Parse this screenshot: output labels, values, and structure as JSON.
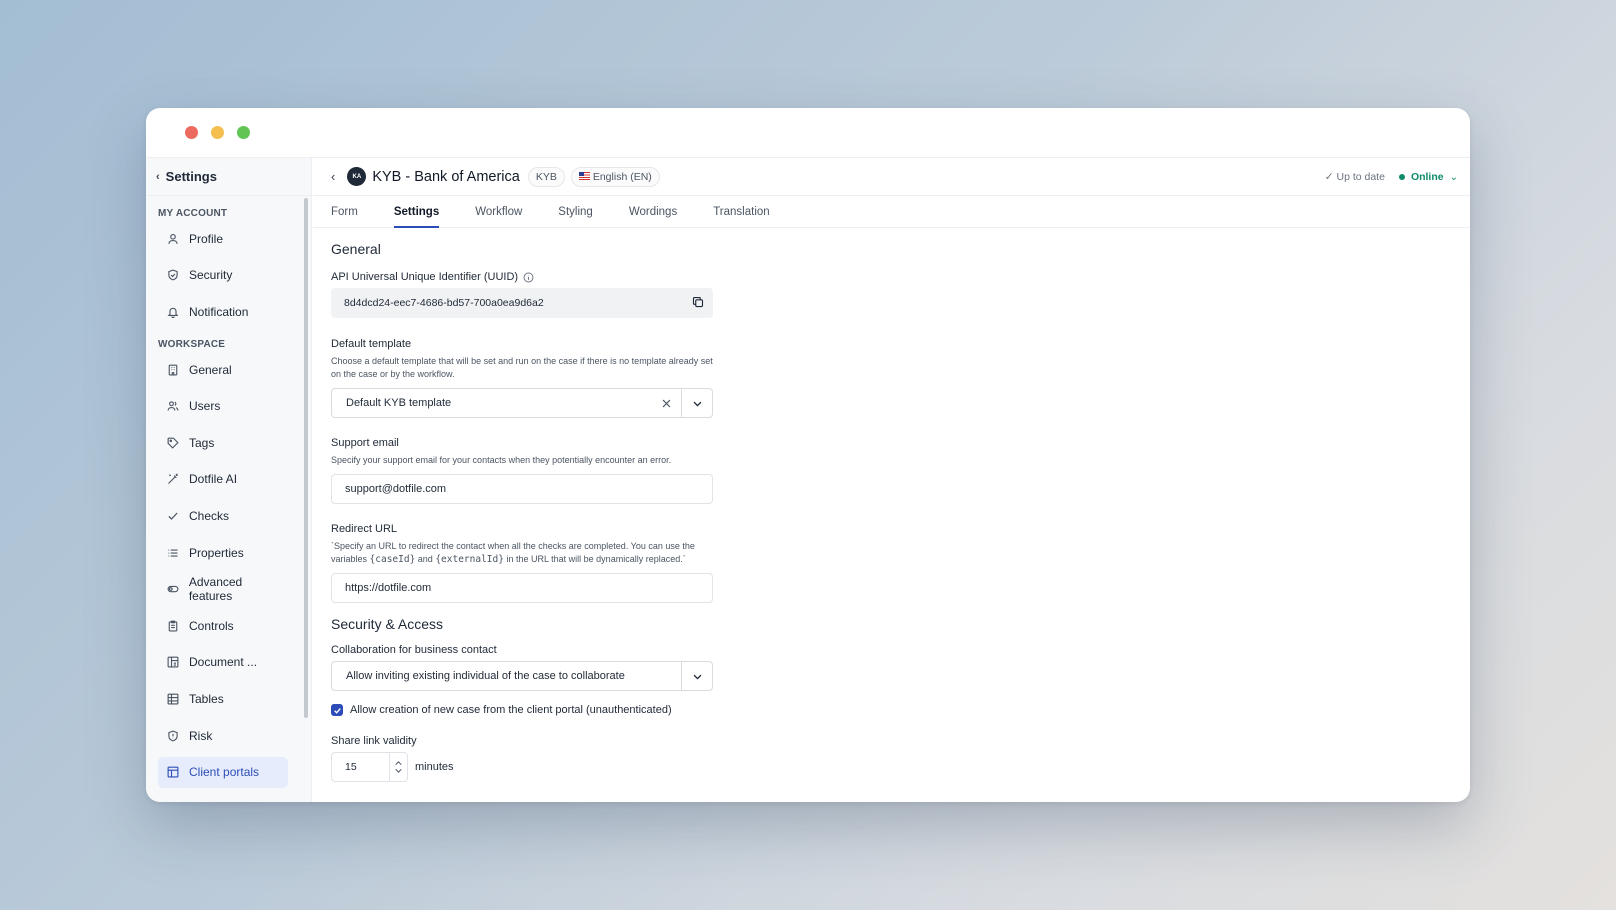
{
  "sidebar": {
    "title": "Settings",
    "sections": [
      {
        "label": "MY ACCOUNT"
      },
      {
        "label": "WORKSPACE"
      }
    ],
    "items": [
      {
        "label": "Profile",
        "icon": "user-icon"
      },
      {
        "label": "Security",
        "icon": "shield-icon"
      },
      {
        "label": "Notification",
        "icon": "bell-icon"
      },
      {
        "label": "General",
        "icon": "building-icon"
      },
      {
        "label": "Users",
        "icon": "users-icon"
      },
      {
        "label": "Tags",
        "icon": "tag-icon"
      },
      {
        "label": "Dotfile AI",
        "icon": "wand-icon"
      },
      {
        "label": "Checks",
        "icon": "check-icon"
      },
      {
        "label": "Properties",
        "icon": "list-icon"
      },
      {
        "label": "Advanced features",
        "icon": "toggle-icon"
      },
      {
        "label": "Controls",
        "icon": "clipboard-icon"
      },
      {
        "label": "Document ...",
        "icon": "document-icon"
      },
      {
        "label": "Tables",
        "icon": "table-icon"
      },
      {
        "label": "Risk",
        "icon": "shield-alert-icon"
      },
      {
        "label": "Client portals",
        "icon": "layout-icon"
      }
    ]
  },
  "header": {
    "avatar_initials": "KA",
    "case_title": "KYB - Bank of America",
    "type_chip": "KYB",
    "language_chip": "English (EN)",
    "status": "Up to date",
    "online": "Online"
  },
  "tabs": [
    {
      "label": "Form"
    },
    {
      "label": "Settings"
    },
    {
      "label": "Workflow"
    },
    {
      "label": "Styling"
    },
    {
      "label": "Wordings"
    },
    {
      "label": "Translation"
    }
  ],
  "general": {
    "title": "General",
    "uuid_label": "API Universal Unique Identifier (UUID)",
    "uuid_value": "8d4dcd24-eec7-4686-bd57-700a0ea9d6a2",
    "template_label": "Default template",
    "template_hint": "Choose a default template that will be set and run on the case if there is no template already set on the case or by the workflow.",
    "template_value": "Default KYB template",
    "support_label": "Support email",
    "support_hint": "Specify your support email for your contacts when they potentially encounter an error.",
    "support_value": "support@dotfile.com",
    "redirect_label": "Redirect URL",
    "redirect_hint_1": "`Specify an URL to redirect the contact when all the checks are completed. You can use the variables ",
    "redirect_var_1": "{caseId}",
    "redirect_hint_and": " and ",
    "redirect_var_2": "{externalId}",
    "redirect_hint_2": " in the URL that will be dynamically replaced.`",
    "redirect_value": "https://dotfile.com"
  },
  "security": {
    "title": "Security & Access",
    "collab_label": "Collaboration for business contact",
    "collab_value": "Allow inviting existing individual of the case to collaborate",
    "checkbox_label": "Allow creation of new case from the client portal (unauthenticated)",
    "checkbox_checked": true,
    "validity_label": "Share link validity",
    "validity_value": "15",
    "validity_unit": "minutes"
  },
  "colors": {
    "accent": "#2c4db8",
    "online": "#0e8a6b"
  }
}
